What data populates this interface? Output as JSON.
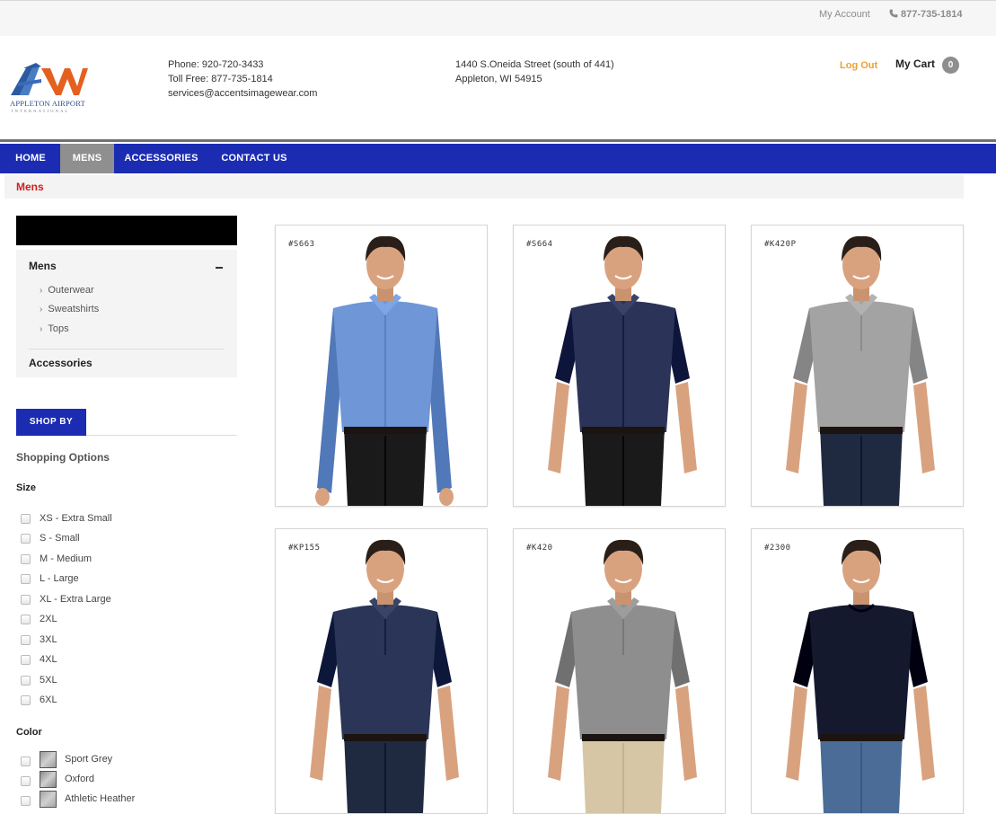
{
  "topbar": {
    "my_account": "My Account",
    "phone": "877-735-1814"
  },
  "header": {
    "logo_text": "APPLETON AIRPORT",
    "logo_subtext": "INTERNATIONAL",
    "phone_line": "Phone: 920-720-3433",
    "tollfree_line": "Toll Free: 877-735-1814",
    "email_line": "services@accentsimagewear.com",
    "address_line1": "1440 S.Oneida Street (south of 441)",
    "address_line2": "Appleton, WI 54915",
    "logout": "Log Out",
    "my_cart": "My Cart",
    "cart_count": "0"
  },
  "nav": {
    "items": [
      {
        "label": "HOME"
      },
      {
        "label": "MENS"
      },
      {
        "label": "ACCESSORIES"
      },
      {
        "label": "CONTACT US"
      }
    ]
  },
  "breadcrumb": {
    "current": "Mens"
  },
  "sidebar": {
    "category": "Mens",
    "subcategories": [
      {
        "label": "Outerwear"
      },
      {
        "label": "Sweatshirts"
      },
      {
        "label": "Tops"
      }
    ],
    "accessories": "Accessories",
    "shop_by": "SHOP BY",
    "shopping_options": "Shopping Options",
    "size_heading": "Size",
    "sizes": [
      {
        "label": "XS - Extra Small"
      },
      {
        "label": "S - Small"
      },
      {
        "label": "M - Medium"
      },
      {
        "label": "L - Large"
      },
      {
        "label": "XL - Extra Large"
      },
      {
        "label": "2XL"
      },
      {
        "label": "3XL"
      },
      {
        "label": "4XL"
      },
      {
        "label": "5XL"
      },
      {
        "label": "6XL"
      }
    ],
    "color_heading": "Color",
    "colors": [
      {
        "label": "Sport Grey",
        "swatch": "#9a9a9a"
      },
      {
        "label": "Oxford",
        "swatch": "#8a8a8a"
      },
      {
        "label": "Athletic Heather",
        "swatch": "#a5a5a5"
      }
    ]
  },
  "products": [
    {
      "sku": "#S663",
      "shirt_color": "#6f96d6",
      "shirt_type": "long-sleeve-button",
      "pants_color": "#1a1a1a"
    },
    {
      "sku": "#S664",
      "shirt_color": "#2b3358",
      "shirt_type": "short-sleeve-button",
      "pants_color": "#1a1a1a"
    },
    {
      "sku": "#K420P",
      "shirt_color": "#a3a3a3",
      "shirt_type": "polo",
      "pants_color": "#1f2a40"
    },
    {
      "sku": "#KP155",
      "shirt_color": "#2a3557",
      "shirt_type": "polo",
      "pants_color": "#1f2a40"
    },
    {
      "sku": "#K420",
      "shirt_color": "#8e8e8e",
      "shirt_type": "polo",
      "pants_color": "#d7c6a5"
    },
    {
      "sku": "#2300",
      "shirt_color": "#14192e",
      "shirt_type": "tee",
      "pants_color": "#4a6c96"
    }
  ],
  "colors": {
    "nav_blue": "#1b2cb3",
    "breadcrumb_red": "#d12020",
    "logout_orange": "#f0a02c"
  }
}
